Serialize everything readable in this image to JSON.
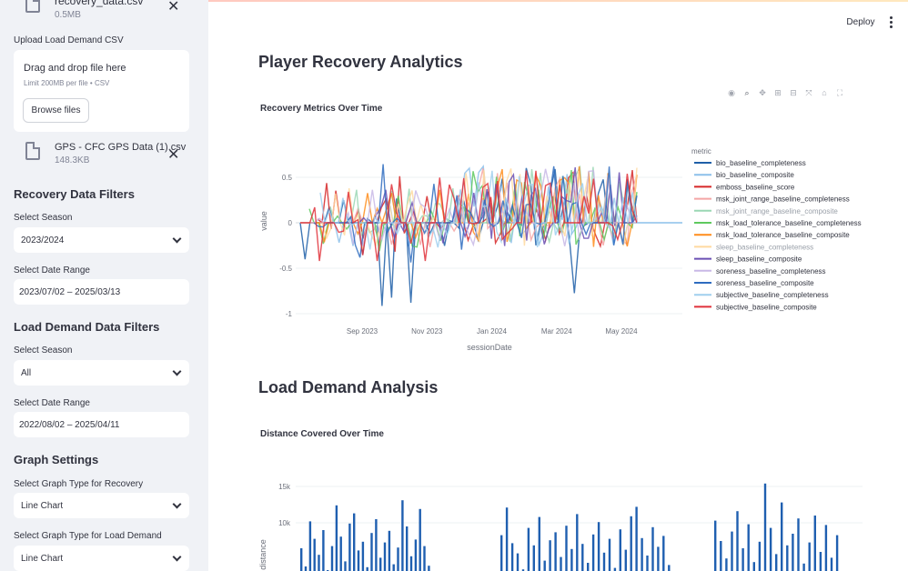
{
  "sidebar": {
    "recovery_file": {
      "name": "recovery_data.csv",
      "size": "0.5MB"
    },
    "load_upload_label": "Upload Load Demand CSV",
    "dropzone": {
      "title": "Drag and drop file here",
      "subtitle": "Limit 200MB per file • CSV",
      "button": "Browse files"
    },
    "load_file": {
      "name": "GPS - CFC GPS Data (1).csv",
      "size": "148.3KB"
    },
    "recovery_filters": {
      "title": "Recovery Data Filters",
      "season_label": "Select Season",
      "season_value": "2023/2024",
      "date_label": "Select Date Range",
      "date_value": "2023/07/02 – 2025/03/13"
    },
    "load_filters": {
      "title": "Load Demand Data Filters",
      "season_label": "Select Season",
      "season_value": "All",
      "date_label": "Select Date Range",
      "date_value": "2022/08/02 – 2025/04/11"
    },
    "graph_settings": {
      "title": "Graph Settings",
      "recovery_label": "Select Graph Type for Recovery",
      "recovery_value": "Line Chart",
      "load_label": "Select Graph Type for Load Demand",
      "load_value": "Line Chart"
    }
  },
  "header": {
    "deploy_label": "Deploy"
  },
  "main": {
    "title": "Player Recovery Analytics",
    "load_title": "Load Demand Analysis"
  },
  "icons": [
    "camera-icon",
    "zoom-icon",
    "pan-icon",
    "zoom-in-icon",
    "zoom-out-icon",
    "autoscale-icon",
    "home-icon",
    "fullscreen-icon"
  ],
  "chart_data": [
    {
      "type": "line",
      "title": "Recovery Metrics Over Time",
      "xlabel": "sessionDate",
      "ylabel": "value",
      "x_ticks": [
        "Sep 2023",
        "Nov 2023",
        "Jan 2024",
        "Mar 2024",
        "May 2024"
      ],
      "y_ticks": [
        0.5,
        0,
        -0.5,
        -1
      ],
      "ylim": [
        -1.05,
        0.85
      ],
      "legend_title": "metric",
      "legend_position": "right",
      "series": [
        {
          "name": "bio_baseline_completeness",
          "color": "#1f5fa8"
        },
        {
          "name": "bio_baseline_composite",
          "color": "#8cc0ea"
        },
        {
          "name": "emboss_baseline_score",
          "color": "#d62728"
        },
        {
          "name": "msk_joint_range_baseline_completeness",
          "color": "#f4a5a5"
        },
        {
          "name": "msk_joint_range_baseline_composite",
          "color": "#9ad7b4"
        },
        {
          "name": "msk_load_tolerance_baseline_completeness",
          "color": "#5ec95e"
        },
        {
          "name": "msk_load_tolerance_baseline_composite",
          "color": "#ff8c1a"
        },
        {
          "name": "sleep_baseline_completeness",
          "color": "#ffd9a0"
        },
        {
          "name": "sleep_baseline_composite",
          "color": "#6a4fb3"
        },
        {
          "name": "soreness_baseline_completeness",
          "color": "#c8b8e6"
        },
        {
          "name": "soreness_baseline_composite",
          "color": "#2e6cc0"
        },
        {
          "name": "subjective_baseline_completeness",
          "color": "#9fcfee"
        },
        {
          "name": "subjective_baseline_composite",
          "color": "#e0313a"
        }
      ]
    },
    {
      "type": "bar",
      "title": "Distance Covered Over Time",
      "ylabel": "distance",
      "y_ticks": [
        "15k",
        "10k"
      ],
      "ylim": [
        0,
        16000
      ],
      "color": "#1f5fb0",
      "values": [
        6500,
        4000,
        10200,
        7800,
        5600,
        9000,
        3500,
        6800,
        12400,
        8100,
        4700,
        9900,
        11300,
        6200,
        7400,
        3900,
        8600,
        10500,
        5200,
        7300,
        8900,
        4300,
        6600,
        13100,
        9500,
        5400,
        7700,
        11900,
        6800,
        4100,
        8300,
        12100,
        7200,
        5800,
        3600,
        9300,
        6900,
        10800,
        4800,
        7600,
        8700,
        5300,
        9600,
        6400,
        11200,
        7100,
        4500,
        8400,
        10100,
        5900,
        7800,
        3800,
        9100,
        6300,
        10900,
        12200,
        7900,
        5500,
        9400,
        6700,
        8200,
        4200,
        10300,
        7500,
        5100,
        8800,
        11600,
        6500,
        9800,
        4600,
        7400,
        15400,
        9300,
        5700,
        12800,
        6900,
        8500,
        10600,
        4400,
        7300,
        11000,
        6000,
        9700,
        5200,
        8300
      ]
    }
  ]
}
